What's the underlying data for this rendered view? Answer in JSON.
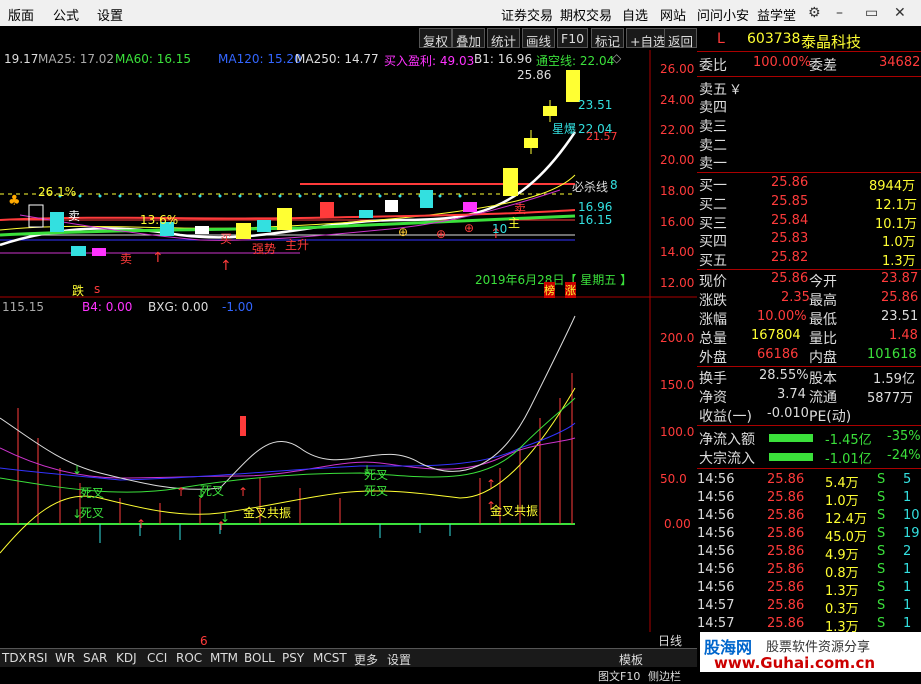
{
  "menu": {
    "items": [
      "版面",
      "公式",
      "设置"
    ],
    "right_items": [
      "证券交易",
      "期权交易",
      "自选",
      "网站",
      "问问小安",
      "益学堂"
    ]
  },
  "toolbar": {
    "buttons": [
      "复权",
      "叠加",
      "统计",
      "画线",
      "F10",
      "标记",
      "+自选",
      "返回"
    ]
  },
  "ma_bar": {
    "ma_a": "19.17",
    "ma25": "MA25: 17.02",
    "ma60": "MA60: 16.15",
    "ma120": "MA120: 15.20",
    "ma250": "MA250: 14.77",
    "buy": "买入盈利: 49.03",
    "b1": "B1: 16.96",
    "tongkong": "通空线: 22.04"
  },
  "y_axis_main": [
    "26.00",
    "24.00",
    "22.00",
    "20.00",
    "18.00",
    "16.00",
    "14.00",
    "12.00"
  ],
  "main_labels": {
    "price_high": "25.86",
    "p2351": "23.51",
    "p2204": "22.04",
    "p2157": "21.57",
    "p1696": "16.96",
    "p1615": "16.15",
    "bishaxian": "必杀线",
    "val18": "8",
    "xinbao": "星爆",
    "pct26": "26.1%",
    "pct13": "13.6%",
    "sell1": "卖",
    "sell2": "卖",
    "mai": "买",
    "sell3": "卖",
    "zhu": "主升",
    "qiangshi": "强势",
    "zhuban": "主",
    "date": "2019年6月28日【 星期五 】",
    "die": "跌",
    "s_glyph": "s",
    "bang": "榜",
    "zhang": "涨",
    "ten": "10"
  },
  "sub_header": {
    "v1": "115.15",
    "b4": "B4: 0.00",
    "bxg": "BXG: 0.00",
    "neg": "-1.00"
  },
  "y_axis_sub": [
    "200.0",
    "150.0",
    "100.0",
    "50.0",
    "0.00"
  ],
  "sub_labels": {
    "sicha1": "死叉",
    "sicha2": "死叉",
    "sicha3": "死叉",
    "sicha4": "死叉",
    "sicha5": "死叉",
    "jincha1": "金叉共振",
    "jincha2": "金叉共振",
    "six": "6"
  },
  "stock": {
    "l": "L",
    "code": "603738",
    "name": "泰晶科技"
  },
  "order": {
    "weibi_label": "委比",
    "weibi": "100.00%",
    "weicha_label": "委差",
    "weicha": "34682",
    "sells": [
      {
        "label": "卖五",
        "price": "￥",
        "vol": ""
      },
      {
        "label": "卖四",
        "price": "",
        "vol": ""
      },
      {
        "label": "卖三",
        "price": "",
        "vol": ""
      },
      {
        "label": "卖二",
        "price": "",
        "vol": ""
      },
      {
        "label": "卖一",
        "price": "",
        "vol": ""
      }
    ],
    "buys": [
      {
        "label": "买一",
        "price": "25.86",
        "vol": "8944万"
      },
      {
        "label": "买二",
        "price": "25.85",
        "vol": "12.1万"
      },
      {
        "label": "买三",
        "price": "25.84",
        "vol": "10.1万"
      },
      {
        "label": "买四",
        "price": "25.83",
        "vol": "1.0万"
      },
      {
        "label": "买五",
        "price": "25.82",
        "vol": "1.3万"
      }
    ]
  },
  "quote": [
    {
      "l1": "现价",
      "v1": "25.86",
      "l2": "今开",
      "v2": "23.87"
    },
    {
      "l1": "涨跌",
      "v1": "2.35",
      "l2": "最高",
      "v2": "25.86"
    },
    {
      "l1": "涨幅",
      "v1": "10.00%",
      "l2": "最低",
      "v2": "23.51"
    },
    {
      "l1": "总量",
      "v1": "167804",
      "l2": "量比",
      "v2": "1.48"
    },
    {
      "l1": "外盘",
      "v1": "66186",
      "l2": "内盘",
      "v2": "101618"
    },
    {
      "l1": "换手",
      "v1": "28.55%",
      "l2": "股本",
      "v2": "1.59亿"
    },
    {
      "l1": "净资",
      "v1": "3.74",
      "l2": "流通",
      "v2": "5877万"
    },
    {
      "l1": "收益(一)",
      "v1": "-0.010",
      "l2": "PE(动)",
      "v2": ""
    }
  ],
  "flow": [
    {
      "label": "净流入额",
      "val": "-1.45亿",
      "pct": "-35%"
    },
    {
      "label": "大宗流入",
      "val": "-1.01亿",
      "pct": "-24%"
    }
  ],
  "ticks": [
    {
      "t": "14:56",
      "p": "25.86",
      "v": "5.4万",
      "s": "S",
      "n": "5"
    },
    {
      "t": "14:56",
      "p": "25.86",
      "v": "1.0万",
      "s": "S",
      "n": "1"
    },
    {
      "t": "14:56",
      "p": "25.86",
      "v": "12.4万",
      "s": "S",
      "n": "10"
    },
    {
      "t": "14:56",
      "p": "25.86",
      "v": "45.0万",
      "s": "S",
      "n": "19"
    },
    {
      "t": "14:56",
      "p": "25.86",
      "v": "4.9万",
      "s": "S",
      "n": "2"
    },
    {
      "t": "14:56",
      "p": "25.86",
      "v": "0.8万",
      "s": "S",
      "n": "1"
    },
    {
      "t": "14:56",
      "p": "25.86",
      "v": "1.3万",
      "s": "S",
      "n": "1"
    },
    {
      "t": "14:57",
      "p": "25.86",
      "v": "0.3万",
      "s": "S",
      "n": "1"
    },
    {
      "t": "14:57",
      "p": "25.86",
      "v": "1.3万",
      "s": "S",
      "n": "1"
    }
  ],
  "bottom": {
    "tabs": [
      "TDX",
      "RSI",
      "WR",
      "SAR",
      "KDJ",
      "CCI",
      "ROC",
      "MTM",
      "BOLL",
      "PSY",
      "MCST",
      "更多",
      "设置"
    ],
    "rixian": "日线",
    "muban": "模板",
    "f10": "图文F10",
    "side": "侧边栏"
  },
  "watermark": {
    "l1": "股海网",
    "l2": "股票软件资源分享",
    "l3": "www.Guhai.com.cn"
  }
}
